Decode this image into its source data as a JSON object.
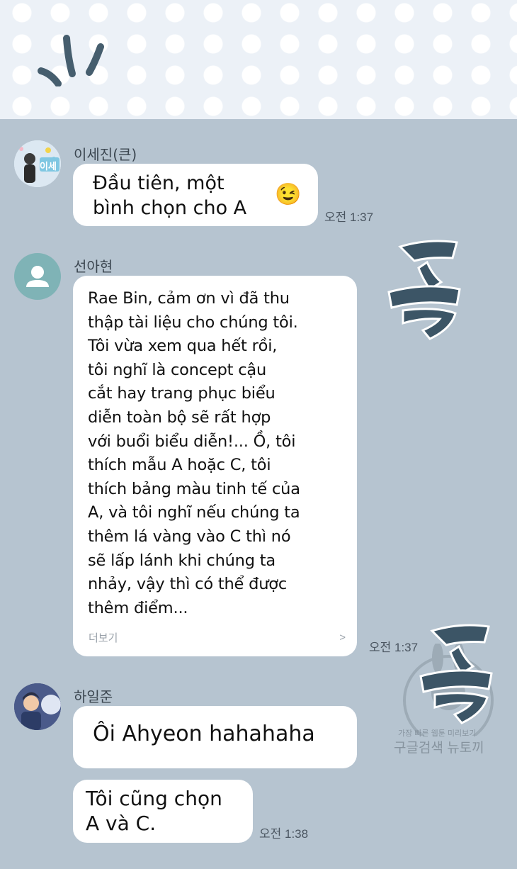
{
  "messages": [
    {
      "sender": "이세진(큰)",
      "avatar_text": "이세",
      "bubbles": [
        {
          "text": "Đầu tiên, một\nbình chọn cho A",
          "emoji": "😉"
        }
      ],
      "time": "오전 1:37"
    },
    {
      "sender": "선아현",
      "bubbles": [
        {
          "text": "Rae Bin, cảm ơn vì đã thu\nthập tài liệu cho chúng tôi.\nTôi vừa xem qua hết rồi,\ntôi nghĩ là concept cậu\ncắt hay trang phục biểu\ndiễn toàn bộ sẽ rất hợp\nvới buổi biểu diễn!... Ồ, tôi\nthích mẫu A hoặc C, tôi\nthích bảng màu tinh tế của\nA, và tôi nghĩ nếu chúng ta\nthêm lá vàng vào C thì nó\nsẽ lấp lánh khi chúng ta\nnhảy, vậy thì có thể được\nthêm điểm...",
          "more_label": "더보기",
          "more_arrow": ">"
        }
      ],
      "time": "오전 1:37"
    },
    {
      "sender": "하일준",
      "bubbles": [
        {
          "text": "Ôi Ahyeon hahahaha"
        },
        {
          "text": "Tôi cũng chọn\nA và C."
        }
      ],
      "time": "오전 1:38"
    }
  ],
  "watermark": {
    "line1": "가장 빠른 웹툰 미리보기",
    "line2": "구글검색 뉴토끼"
  },
  "colors": {
    "chat_background": "#b6c4d0",
    "bubble": "#ffffff",
    "sfx": "#3c5566",
    "default_avatar": "#7fb3b6"
  }
}
